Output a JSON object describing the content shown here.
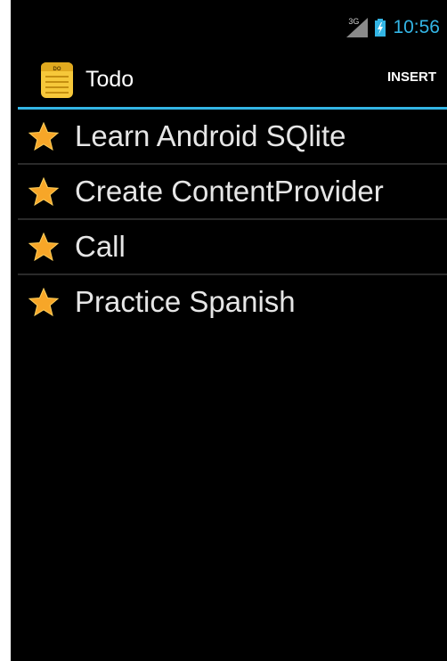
{
  "status_bar": {
    "network": "3G",
    "time": "10:56",
    "icons": [
      "signal-icon",
      "battery-icon"
    ]
  },
  "action_bar": {
    "title": "Todo",
    "icon": "notepad-icon",
    "insert_label": "INSERT"
  },
  "todos": [
    {
      "label": "Learn Android SQlite",
      "icon": "star-icon"
    },
    {
      "label": "Create ContentProvider",
      "icon": "star-icon"
    },
    {
      "label": "Call",
      "icon": "star-icon"
    },
    {
      "label": "Practice Spanish",
      "icon": "star-icon"
    }
  ],
  "colors": {
    "accent": "#33b5e5",
    "background": "#000000",
    "star": "#f5a623"
  }
}
